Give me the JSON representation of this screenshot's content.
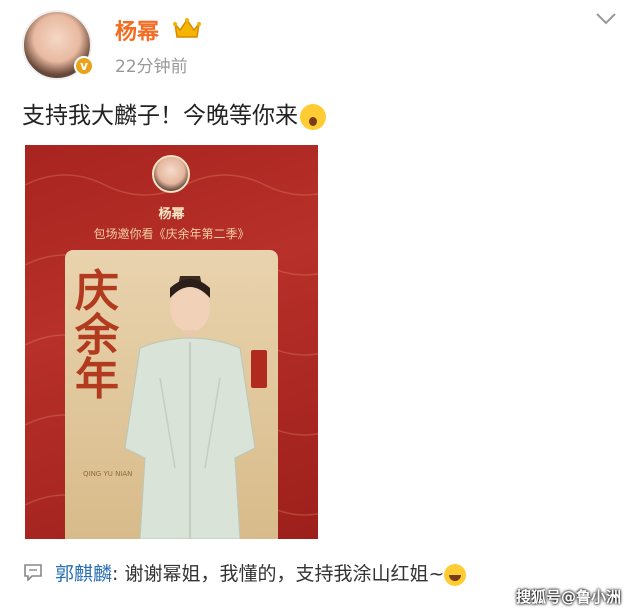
{
  "post": {
    "username": "杨幂",
    "time": "22分钟前",
    "text": "支持我大麟子！今晚等你来"
  },
  "poster": {
    "name": "杨幂",
    "invite": "包场邀你看《庆余年第二季》",
    "show_title": "庆余年",
    "pinyin": "QING YU NIAN"
  },
  "comment": {
    "author": "郭麒麟",
    "text": ": 谢谢幂姐，我懂的，支持我涂山红姐~"
  },
  "watermark": "搜狐号@鲁小洲",
  "colors": {
    "username": "#f36c21",
    "comment_author": "#2a6fb5",
    "poster_bg": "#a8241f"
  }
}
